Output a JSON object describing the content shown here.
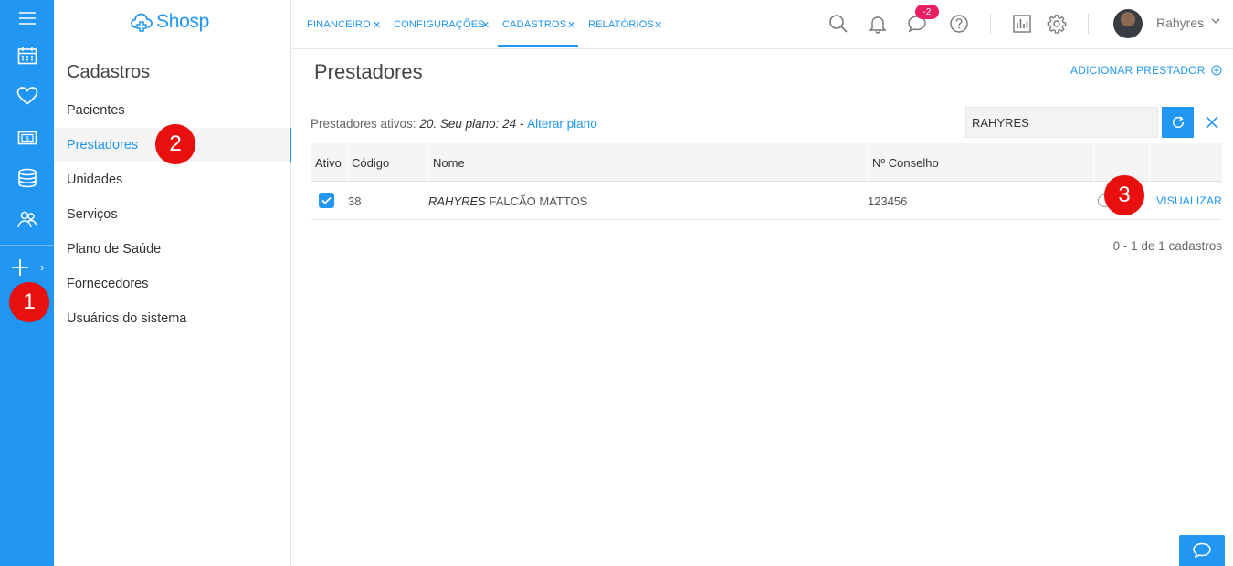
{
  "brand": {
    "name": "Shosp"
  },
  "rail": {
    "items": [
      "menu-icon",
      "calendar-icon",
      "heart-icon",
      "money-icon",
      "database-icon",
      "users-icon",
      "plus-icon"
    ],
    "accent": "#2196f3"
  },
  "markers": {
    "m1": "1",
    "m2": "2",
    "m3": "3"
  },
  "sidebar": {
    "title": "Cadastros",
    "items": [
      {
        "label": "Pacientes"
      },
      {
        "label": "Prestadores"
      },
      {
        "label": "Unidades"
      },
      {
        "label": "Serviços"
      },
      {
        "label": "Plano de Saúde"
      },
      {
        "label": "Fornecedores"
      },
      {
        "label": "Usuários do sistema"
      }
    ],
    "active": "Prestadores"
  },
  "tabs": [
    {
      "label": "FINANCEIRO"
    },
    {
      "label": "CONFIGURAÇÕES"
    },
    {
      "label": "CADASTROS"
    },
    {
      "label": "RELATÓRIOS"
    }
  ],
  "active_tab": "CADASTROS",
  "header": {
    "messages_badge": "-2",
    "user_name": "Rahyres",
    "badge_color": "#e91e63"
  },
  "main": {
    "title": "Prestadores",
    "add_label": "ADICIONAR PRESTADOR",
    "info_prefix": "Prestadores ativos: ",
    "info_italic": "20. Seu plano: 24 - ",
    "info_link": "Alterar plano",
    "search_value": "RAHYRES"
  },
  "table": {
    "columns": [
      "Ativo",
      "Código",
      "Nome",
      "Nº Conselho"
    ],
    "rows": [
      {
        "active": true,
        "code": "38",
        "name_italic": "RAHYRES",
        "name_rest": " FALCÃO MATTOS",
        "council": "123456",
        "action": "VISUALIZAR"
      }
    ]
  },
  "pagination": {
    "text": "0 - 1 de 1 cadastros"
  }
}
